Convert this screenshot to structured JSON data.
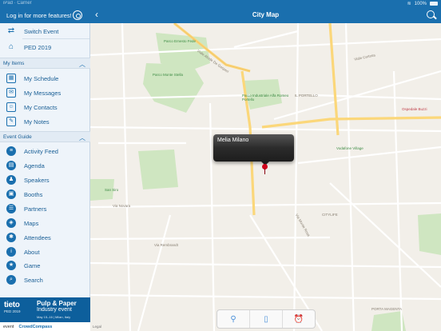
{
  "status": {
    "carrier": "iPad · Carrier",
    "battery": "100%"
  },
  "sidebar": {
    "login": "Log in for more features!",
    "top_items": [
      {
        "label": "Switch Event",
        "icon": "switch-icon"
      },
      {
        "label": "PED 2019",
        "icon": "home-icon"
      }
    ],
    "my_items_header": "My Items",
    "my_items": [
      {
        "label": "My Schedule",
        "icon": "calendar-icon"
      },
      {
        "label": "My Messages",
        "icon": "messages-icon"
      },
      {
        "label": "My Contacts",
        "icon": "contacts-icon"
      },
      {
        "label": "My Notes",
        "icon": "notes-icon"
      }
    ],
    "guide_header": "Event Guide",
    "guide_items": [
      {
        "label": "Activity Feed",
        "icon": "activity-icon"
      },
      {
        "label": "Agenda",
        "icon": "agenda-icon"
      },
      {
        "label": "Speakers",
        "icon": "speakers-icon"
      },
      {
        "label": "Booths",
        "icon": "booths-icon"
      },
      {
        "label": "Partners",
        "icon": "partners-icon"
      },
      {
        "label": "Maps",
        "icon": "maps-icon"
      },
      {
        "label": "Attendees",
        "icon": "attendees-icon"
      },
      {
        "label": "About",
        "icon": "about-icon"
      },
      {
        "label": "Game",
        "icon": "game-icon"
      },
      {
        "label": "Search",
        "icon": "search-icon"
      }
    ],
    "banner": {
      "brand": "tieto",
      "brand_sub": "PED 2019",
      "title1": "Pulp & Paper",
      "title2": "Industry event",
      "dates": "May 15–16 | Milan, Italy",
      "footer_left": "event",
      "footer_right": "CrowdCompass"
    }
  },
  "header": {
    "title": "City Map"
  },
  "map": {
    "callout": "Melia Milano",
    "legal": "Legal",
    "labels": {
      "parco_ernesto": "Parco Ernesto Fede",
      "parco_monte_stella": "Parco Monte Stella",
      "parco_portello": "Parco Industriale Alfa Romeo Portello",
      "portello": "IL PORTELLO",
      "citylife": "CITYLIFE",
      "porta_magenta": "PORTA MAGENTA",
      "ospedale": "Ospedale Buzzi",
      "vodafone": "Vodafone Village",
      "san_siro": "San Siro",
      "viale_certosa": "Viale Certosa",
      "via_novara": "Via Novara",
      "viale_alcide": "Viale Alcide De Gasperi",
      "via_rembrandt": "Via Rembrandt",
      "via_monte_rosa": "Via Monte Rosa"
    },
    "toolbar": {
      "pin": "pin-icon",
      "bookmark": "bookmark-icon",
      "alarm": "alarm-icon"
    }
  },
  "colors": {
    "brand": "#1a6fae",
    "park": "#cfe6c1",
    "road_major": "#fbd77a",
    "water": "#aad3f2"
  }
}
